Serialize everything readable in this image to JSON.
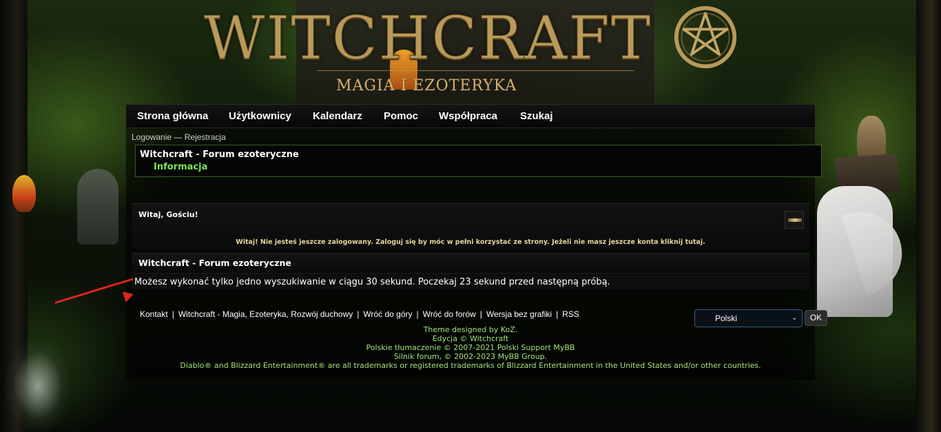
{
  "logo": {
    "title": "WITCHCRAFT",
    "subtitle": "MAGIA I EZOTERYKA"
  },
  "nav": {
    "items": [
      {
        "label": "Strona główna"
      },
      {
        "label": "Użytkownicy"
      },
      {
        "label": "Kalendarz"
      },
      {
        "label": "Pomoc"
      },
      {
        "label": "Współpraca"
      },
      {
        "label": "Szukaj"
      }
    ]
  },
  "userbar": {
    "login": "Logowanie",
    "separator": "—",
    "register": "Rejestracja"
  },
  "breadcrumb": {
    "forum": "Witchcraft - Forum ezoteryczne",
    "current": "Informacja"
  },
  "welcome": {
    "title": "Witaj, Gościu!",
    "text": "Witaj! Nie jesteś jeszcze zalogowany. Zaloguj się by móc w pełni korzystać ze strony. Jeżeli nie masz jeszcze konta kliknij tutaj."
  },
  "message": {
    "header": "Witchcraft - Forum ezoteryczne",
    "body": "Możesz wykonać tylko jedno wyszukiwanie w ciągu 30 sekund. Poczekaj 23 sekund przed następną próbą."
  },
  "footer": {
    "links": [
      {
        "label": "Kontakt"
      },
      {
        "label": "Witchcraft - Magia, Ezoteryka, Rozwój duchowy"
      },
      {
        "label": "Wróć do góry"
      },
      {
        "label": "Wróć do forów"
      },
      {
        "label": "Wersja bez grafiki"
      },
      {
        "label": "RSS"
      }
    ],
    "separator": "|",
    "language": "Polski",
    "ok": "OK",
    "credits": [
      "Theme designed by KoZ.",
      "Edycja © Witchcraft",
      "Polskie tłumaczenie © 2007-2021 Polski Support MyBB",
      "Silnik forum, © 2002-2023 MyBB Group.",
      "Diablo® and Blizzard Entertainment® are all trademarks or registered trademarks of Blizzard Entertainment in the United States and/or other countries."
    ]
  },
  "colors": {
    "accent_green": "#7ee35a",
    "credits_green": "#a3e27a",
    "welcome_gold": "#e8d49a",
    "logo_gold": "#b99a5a",
    "arrow_red": "#e0241b"
  }
}
